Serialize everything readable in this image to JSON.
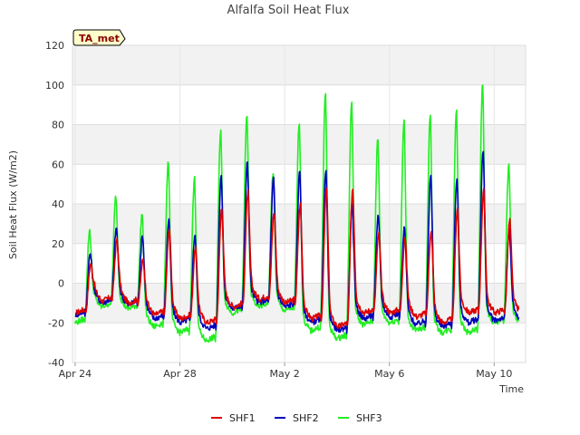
{
  "chart_data": {
    "type": "line",
    "title": "Alfalfa Soil Heat Flux",
    "xlabel": "Time",
    "ylabel": "Soil Heat Flux (W/m2)",
    "badge": "TA_met",
    "ylim": [
      -40,
      120
    ],
    "yticks": [
      -40,
      -20,
      0,
      20,
      40,
      60,
      80,
      100,
      120
    ],
    "xlim_days": [
      -0.1,
      17.2
    ],
    "xticks": [
      {
        "day": 0,
        "label": "Apr 24"
      },
      {
        "day": 4,
        "label": "Apr 28"
      },
      {
        "day": 8,
        "label": "May 2"
      },
      {
        "day": 12,
        "label": "May 6"
      },
      {
        "day": 16,
        "label": "May 10"
      }
    ],
    "grid": true,
    "legend_position": "bottom-center",
    "series": [
      {
        "name": "SHF1",
        "color": "#dd0000",
        "daily_min": [
          -15,
          -9,
          -10,
          -16,
          -18,
          -20,
          -12,
          -8,
          -10,
          -18,
          -22,
          -15,
          -15,
          -17,
          -20,
          -15,
          -15
        ],
        "daily_peak": [
          10,
          22,
          12,
          28,
          18,
          38,
          46,
          36,
          40,
          48,
          48,
          25,
          24,
          27,
          38,
          47,
          32
        ]
      },
      {
        "name": "SHF2",
        "color": "#0000bb",
        "daily_min": [
          -16,
          -10,
          -11,
          -18,
          -20,
          -23,
          -13,
          -10,
          -12,
          -20,
          -24,
          -18,
          -17,
          -21,
          -22,
          -20,
          -19
        ],
        "daily_peak": [
          15,
          28,
          24,
          32,
          25,
          55,
          61,
          53,
          57,
          58,
          39,
          35,
          28,
          54,
          53,
          67,
          27
        ]
      },
      {
        "name": "SHF3",
        "color": "#22ee22",
        "daily_min": [
          -20,
          -12,
          -13,
          -22,
          -25,
          -29,
          -15,
          -12,
          -14,
          -24,
          -28,
          -21,
          -20,
          -24,
          -25,
          -25,
          -20
        ],
        "daily_peak": [
          27,
          44,
          35,
          62,
          53,
          78,
          85,
          56,
          82,
          97,
          92,
          73,
          82,
          86,
          88,
          102,
          60
        ]
      }
    ]
  }
}
